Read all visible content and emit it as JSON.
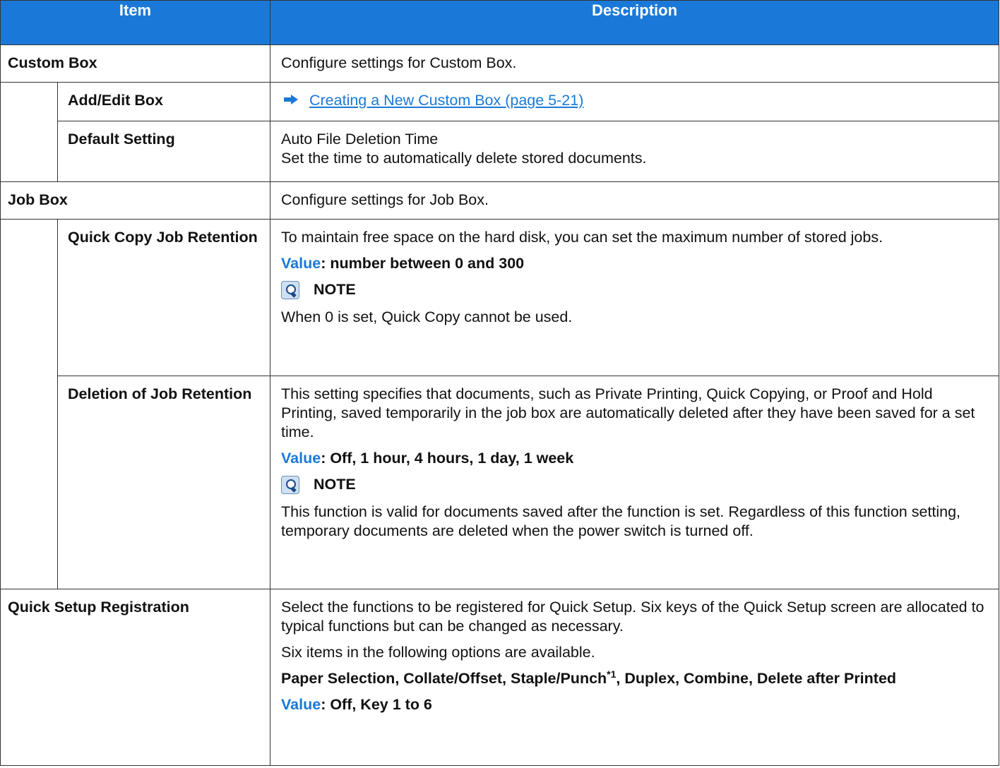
{
  "header": {
    "item": "Item",
    "description": "Description"
  },
  "rows": {
    "custom_box": {
      "label": "Custom Box",
      "desc": "Configure settings for Custom Box."
    },
    "add_edit_box": {
      "label": "Add/Edit Box",
      "link": "Creating a New Custom Box (page 5-21)"
    },
    "default_setting": {
      "label": "Default Setting",
      "line1": "Auto File Deletion Time",
      "line2": "Set the time to automatically delete stored documents."
    },
    "job_box": {
      "label": "Job Box",
      "desc": "Configure settings for Job Box."
    },
    "quick_copy": {
      "label": "Quick Copy Job Retention",
      "desc": "To maintain free space on the hard disk, you can set the maximum number of stored jobs.",
      "value_label": "Value",
      "value_text": ": number between 0 and 300",
      "note_title": "NOTE",
      "note_text": "When 0 is set, Quick Copy cannot be used."
    },
    "deletion": {
      "label": "Deletion of Job Retention",
      "desc": "This setting specifies that documents, such as Private Printing, Quick Copying, or Proof and Hold Printing, saved temporarily in the job box are automatically deleted after they have been saved for a set time.",
      "value_label": "Value",
      "value_text": ": Off, 1 hour, 4 hours, 1 day, 1 week",
      "note_title": "NOTE",
      "note_text": "This function is valid for documents saved after the function is set. Regardless of this function setting, temporary documents are deleted when the power switch is turned off."
    },
    "quick_setup": {
      "label": "Quick Setup Registration",
      "desc": "Select the functions to be registered for Quick Setup. Six keys of the Quick Setup screen are allocated to typical functions but can be changed as necessary.",
      "avail": "Six items in the following options are available.",
      "options_a": "Paper Selection, Collate/Offset, Staple/Punch",
      "options_sup": "*1",
      "options_b": ", Duplex, Combine, Delete after Printed",
      "value_label": "Value",
      "value_text": ": Off, Key 1 to 6"
    }
  }
}
